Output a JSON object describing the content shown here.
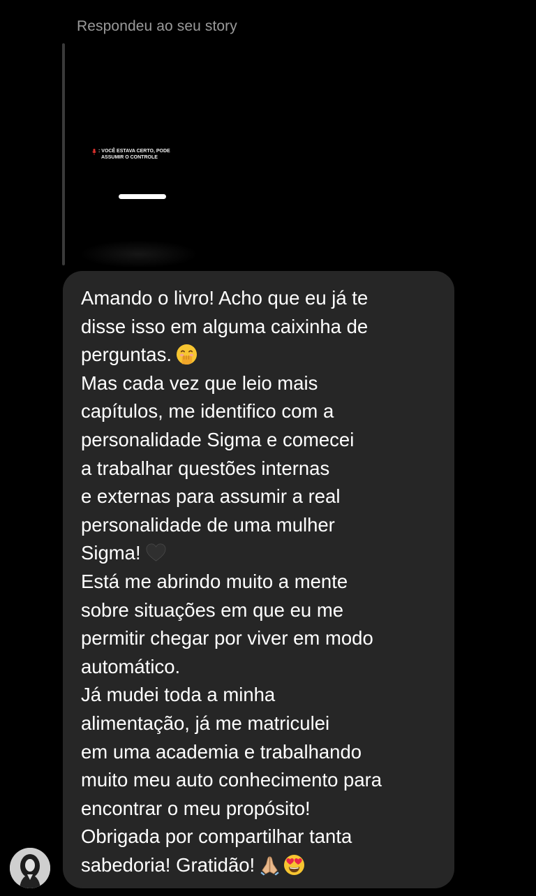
{
  "reply_header": "Respondeu ao seu story",
  "story": {
    "caption_line1": ": VOCÊ ESTAVA CERTO, PODE",
    "caption_line2": "ASSUMIR O CONTROLE",
    "mic_icon": "microphone-icon",
    "accent_color": "#e0322e"
  },
  "message": {
    "lines": [
      "Amando o livro! Acho que eu já te",
      "disse isso em alguma caixinha de",
      "perguntas.",
      "Mas cada vez que leio mais",
      "capítulos, me identifico com a",
      "personalidade Sigma e comecei",
      "a trabalhar questões internas",
      "e externas para assumir a real",
      "personalidade de uma mulher",
      "Sigma!",
      "Está me abrindo muito a mente",
      "sobre situações em que eu me",
      "permitir chegar por viver em modo",
      "automático.",
      "Já mudei toda a minha",
      "alimentação, já me matriculei",
      "em uma academia e trabalhando",
      "muito meu auto conhecimento para",
      "encontrar o meu propósito!",
      "Obrigada por compartilhar tanta",
      "sabedoria! Gratidão!"
    ],
    "emojis": {
      "line3": "face-with-hand-over-mouth-emoji",
      "line10": "black-heart-emoji",
      "line21a": "folded-hands-emoji",
      "line21b": "heart-eyes-emoji"
    },
    "bubble_color": "#262626"
  },
  "avatar": "user-avatar"
}
